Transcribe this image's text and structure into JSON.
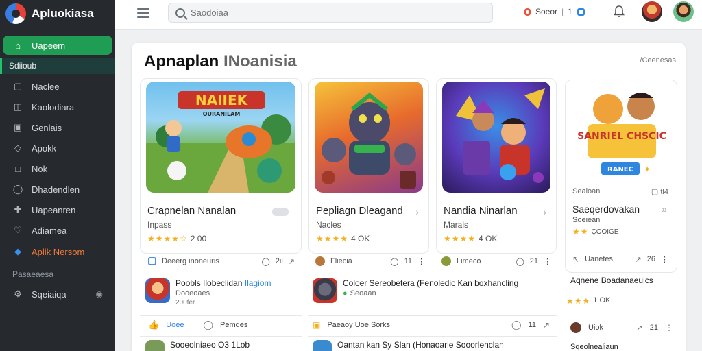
{
  "app": {
    "name": "Apluokiasa"
  },
  "sidebar": {
    "items": [
      {
        "label": "Uapeem",
        "icon": "home-icon"
      },
      {
        "label": "Sdiioub",
        "icon": "grid-icon"
      },
      {
        "label": "Naclee",
        "icon": "box-icon"
      },
      {
        "label": "Kaolodiara",
        "icon": "chart-icon"
      },
      {
        "label": "Genlais",
        "icon": "photo-icon"
      },
      {
        "label": "Apokk",
        "icon": "tag-icon"
      },
      {
        "label": "Nok",
        "icon": "square-icon"
      },
      {
        "label": "Dhadendlen",
        "icon": "chat-icon"
      },
      {
        "label": "Uapeanren",
        "icon": "puzzle-icon"
      },
      {
        "label": "Adiamea",
        "icon": "heart-icon"
      },
      {
        "label": "Aplik Nersom",
        "icon": "diamond-icon"
      }
    ],
    "section_label": "Pasaeaesa",
    "bottom_item": {
      "label": "Sqeiaiqa",
      "icon": "settings-icon"
    }
  },
  "topbar": {
    "search_placeholder": "Saodoiaa",
    "coins_label": "Soeor",
    "coins_count": "1"
  },
  "main": {
    "title_dark": "Apnaplan",
    "title_light": "INoanisia",
    "see_all": "/Ceenesas",
    "cards": [
      {
        "title": "Crapnelan Nanalan",
        "subtitle": "Inpass",
        "rating_text": "2 00",
        "footer_label": "Deeerg inoneuris",
        "comments": "2il",
        "art_title": "NAIIEK",
        "art_sub": "OURANILAM"
      },
      {
        "title": "Pepliagn Dleagand",
        "subtitle": "Nacles",
        "rating_text": "4 OK",
        "footer_label": "Fliecia",
        "comments": "11"
      },
      {
        "title": "Nandia Ninarlan",
        "subtitle": "Marals",
        "rating_text": "4 OK",
        "footer_label": "Limeco",
        "comments": "21"
      },
      {
        "title": "Saeqerdovakan",
        "subtitle": "Soeiean",
        "rating_text": "ÇOOIGE",
        "top_label": "Seaioan",
        "top_count": "tl4",
        "footer_label": "Uanetes",
        "comments": "26",
        "art_title": "SANRIEL CHSCIC",
        "art_badge": "RANEC"
      }
    ],
    "list": [
      {
        "title": "Poobls Ilobeclidan",
        "highlight": "Ilagiom",
        "line2": "Dooeoaes",
        "line3": "200fer"
      },
      {
        "title": "Coloer Sereobetera (Fenoledic Kan boxhancling",
        "line2": "Seoaan"
      }
    ],
    "actions_left": {
      "like": "Uoee",
      "comment": "Pemdes"
    },
    "actions_mid": {
      "label": "Paeaoy Uoe Sorks",
      "comments": "11"
    },
    "right_extra": {
      "title": "Aqnene Boadanaeulcs",
      "rating_text": "1 OK",
      "user": "Uiok",
      "comments": "21",
      "bottom": "Sqeolnealiaun"
    },
    "list_bottom_left": "Sooeolniaeo O3 1Lob",
    "list_bottom_mid": "Oantan kan Sy Slan (Honaoarle Sooorlenclan"
  }
}
